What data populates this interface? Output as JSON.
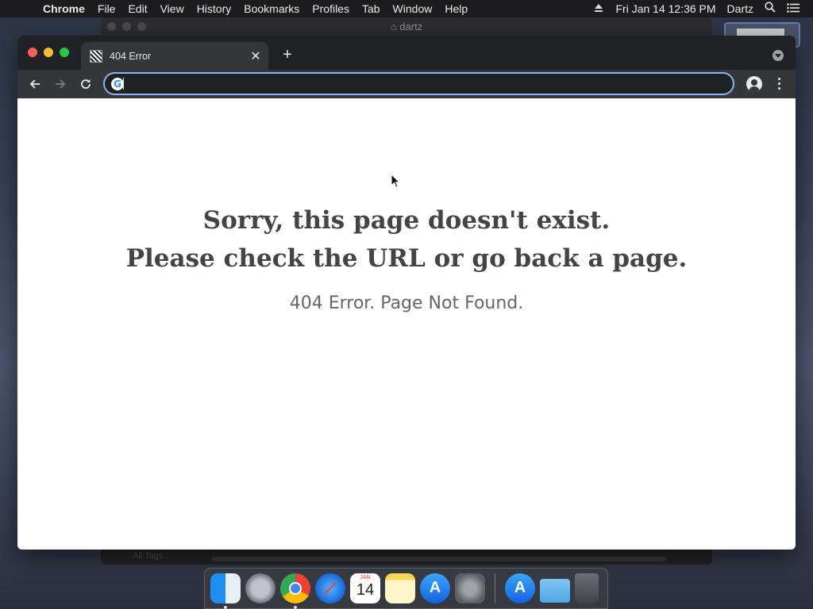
{
  "menubar": {
    "apple_icon": "apple-logo-icon",
    "app_name": "Chrome",
    "menus": [
      "File",
      "Edit",
      "View",
      "History",
      "Bookmarks",
      "Profiles",
      "Tab",
      "Window",
      "Help"
    ],
    "datetime": "Fri Jan 14  12:36 PM",
    "user": "Dartz"
  },
  "background_window": {
    "title": "dartz",
    "sidebar_stub": "All Tags..."
  },
  "browser": {
    "tab": {
      "title": "404 Error"
    },
    "omnibox": {
      "value": "",
      "placeholder": ""
    }
  },
  "page": {
    "headline_line1": "Sorry, this page doesn't exist.",
    "headline_line2": "Please check the URL or go back a page.",
    "subline": "404 Error. Page Not Found."
  },
  "dock": {
    "apps": [
      "Finder",
      "Launchpad",
      "Google Chrome",
      "Safari",
      "Calendar",
      "Notes",
      "App Store",
      "System Preferences"
    ],
    "calendar": {
      "month": "JAN",
      "day": "14"
    }
  },
  "colors": {
    "omnibox_focus": "#8ab4f8",
    "tabstrip_bg": "#202124",
    "toolbar_bg": "#35363a",
    "headline_text": "#444444"
  }
}
